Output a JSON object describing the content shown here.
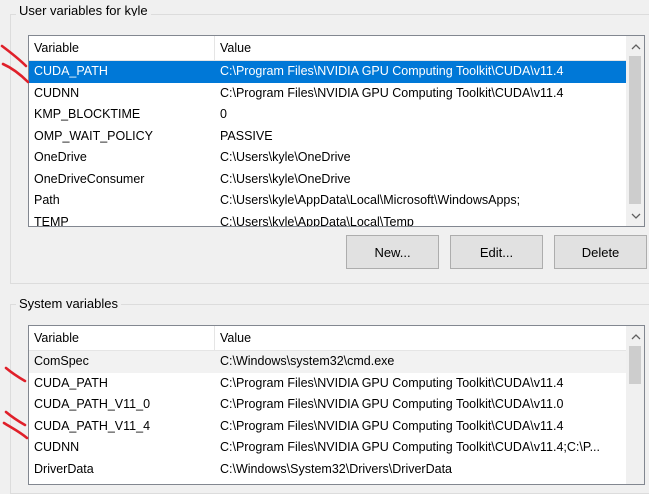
{
  "user_vars": {
    "group_label": "User variables for kyle",
    "columns": {
      "variable": "Variable",
      "value": "Value"
    },
    "rows": [
      {
        "name": "CUDA_PATH",
        "value": "C:\\Program Files\\NVIDIA GPU Computing Toolkit\\CUDA\\v11.4",
        "selected": true
      },
      {
        "name": "CUDNN",
        "value": "C:\\Program Files\\NVIDIA GPU Computing Toolkit\\CUDA\\v11.4"
      },
      {
        "name": "KMP_BLOCKTIME",
        "value": "0"
      },
      {
        "name": "OMP_WAIT_POLICY",
        "value": "PASSIVE"
      },
      {
        "name": "OneDrive",
        "value": "C:\\Users\\kyle\\OneDrive"
      },
      {
        "name": "OneDriveConsumer",
        "value": "C:\\Users\\kyle\\OneDrive"
      },
      {
        "name": "Path",
        "value": "C:\\Users\\kyle\\AppData\\Local\\Microsoft\\WindowsApps;"
      },
      {
        "name": "TEMP",
        "value": "C:\\Users\\kyle\\AppData\\Local\\Temp"
      }
    ],
    "buttons": {
      "new": "New...",
      "edit": "Edit...",
      "delete": "Delete"
    }
  },
  "system_vars": {
    "group_label": "System variables",
    "columns": {
      "variable": "Variable",
      "value": "Value"
    },
    "rows": [
      {
        "name": "ComSpec",
        "value": "C:\\Windows\\system32\\cmd.exe",
        "hover": true
      },
      {
        "name": "CUDA_PATH",
        "value": "C:\\Program Files\\NVIDIA GPU Computing Toolkit\\CUDA\\v11.4"
      },
      {
        "name": "CUDA_PATH_V11_0",
        "value": "C:\\Program Files\\NVIDIA GPU Computing Toolkit\\CUDA\\v11.0"
      },
      {
        "name": "CUDA_PATH_V11_4",
        "value": "C:\\Program Files\\NVIDIA GPU Computing Toolkit\\CUDA\\v11.4"
      },
      {
        "name": "CUDNN",
        "value": "C:\\Program Files\\NVIDIA GPU Computing Toolkit\\CUDA\\v11.4;C:\\P..."
      },
      {
        "name": "DriverData",
        "value": "C:\\Windows\\System32\\Drivers\\DriverData"
      }
    ]
  },
  "colors": {
    "selection": "#0078d7",
    "annotation": "#e0202a"
  },
  "icons": {
    "scroll_up": "chevron-up-icon",
    "scroll_down": "chevron-down-icon"
  }
}
